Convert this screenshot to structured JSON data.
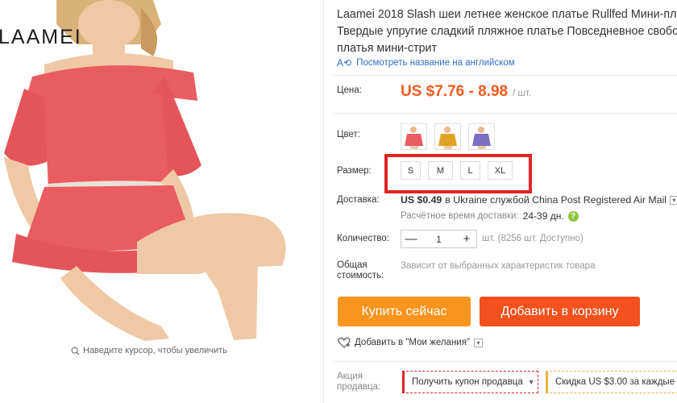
{
  "gallery": {
    "brand": "LAAMEI",
    "zoom_hint": "Наведите курсор, чтобы увеличить"
  },
  "product": {
    "title_lines": [
      "Laamei 2018 Slash шеи летнее женское платье Rullfed Мини-пла",
      "Твердые упругие сладкий пляжное платье Повседневное свобо",
      "платья мини-стрит"
    ],
    "translate_link": "Посмотреть название на английском"
  },
  "price": {
    "label": "Цена:",
    "value": "US $7.76 - 8.98",
    "unit": "/ шт."
  },
  "color": {
    "label": "Цвет:",
    "options": [
      "pink",
      "yellow",
      "purple"
    ]
  },
  "size": {
    "label": "Размер:",
    "options": [
      "S",
      "M",
      "L",
      "XL"
    ]
  },
  "shipping": {
    "label": "Доставка:",
    "price": "US $0.49",
    "text": "в Ukraine службой China Post Registered Air Mail",
    "eta_label": "Расчётное время доставки:",
    "eta_value": "24-39 дн.",
    "help": "?"
  },
  "quantity": {
    "label": "Количество:",
    "value": "1",
    "minus": "—",
    "plus": "+",
    "stock": "шт. (8256 шт. Доступно)"
  },
  "total": {
    "label_line1": "Общая",
    "label_line2": "стоимость:",
    "value": "Зависит от выбранных характеристик товара"
  },
  "actions": {
    "buy_now": "Купить сейчас",
    "add_to_cart": "Добавить в корзину",
    "wishlist": "Добавить в \"Мои желания\""
  },
  "promo": {
    "label_line1": "Акция",
    "label_line2": "продавца:",
    "coupon": "Получить купон продавца",
    "discount": "Скидка US $3.00 за каждые U"
  },
  "colors": {
    "accent_orange": "#f9941e",
    "cart_red": "#f4511e",
    "price": "#f55a1f",
    "highlight_box": "#e02424",
    "link": "#2f6ec9"
  }
}
